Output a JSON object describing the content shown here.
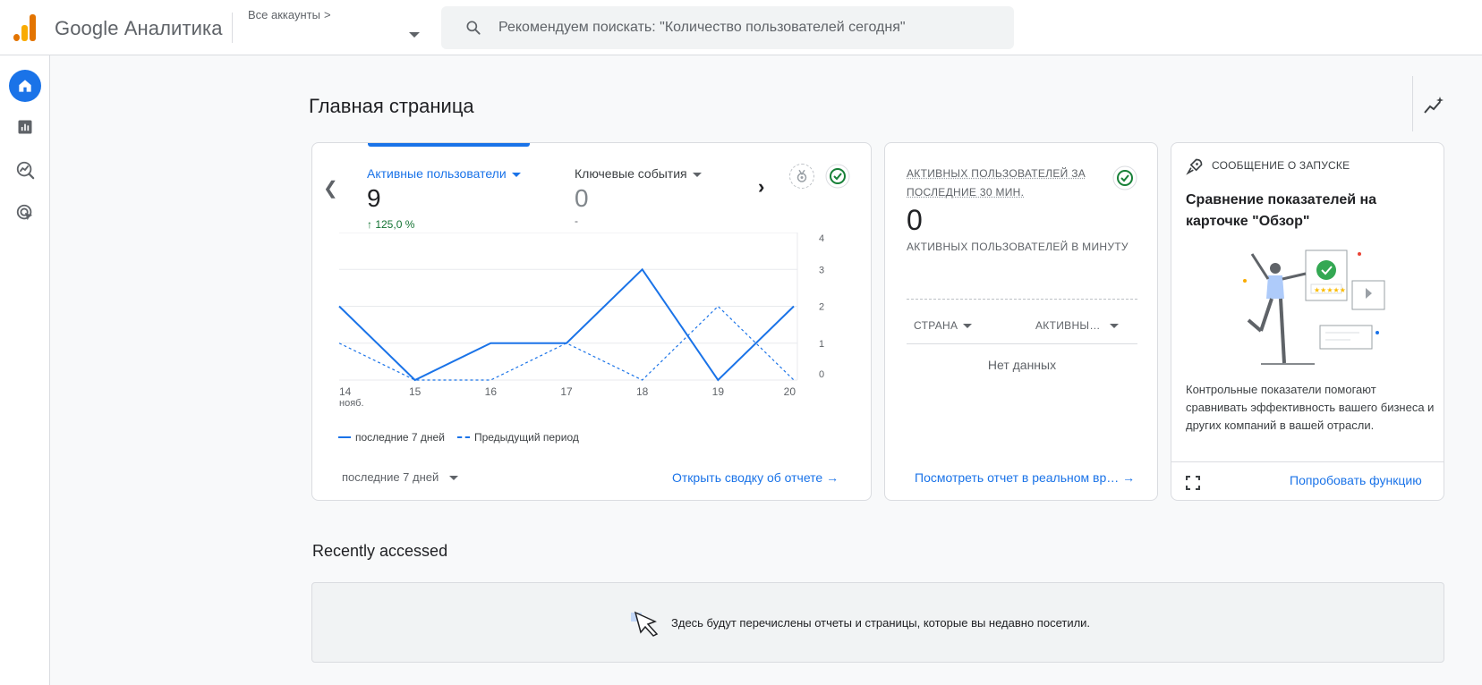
{
  "app": {
    "brand": "Google Аналитика",
    "accounts_label": "Все аккаунты",
    "accounts_chevron": ">"
  },
  "search": {
    "placeholder": "Рекомендуем поискать: \"Количество пользователей сегодня\""
  },
  "nav": {
    "items": [
      {
        "name": "home",
        "icon": "home-icon",
        "active": true
      },
      {
        "name": "reports",
        "icon": "bar-chart-icon",
        "active": false
      },
      {
        "name": "explore",
        "icon": "explore-icon",
        "active": false
      },
      {
        "name": "advertising",
        "icon": "ads-target-icon",
        "active": false
      }
    ]
  },
  "page": {
    "title": "Главная страница"
  },
  "overview_card": {
    "metric1": {
      "label": "Активные пользователи",
      "value": "9",
      "delta": "↑ 125,0 %"
    },
    "metric2": {
      "label": "Ключевые события",
      "value": "0",
      "delta": "-"
    },
    "legend_current": "последние 7 дней",
    "legend_previous": "Предыдущий период",
    "period_select": "последние 7 дней",
    "link": "Открыть сводку об отчете →"
  },
  "chart_data": {
    "type": "line",
    "x": [
      "14",
      "15",
      "16",
      "17",
      "18",
      "19",
      "20"
    ],
    "x_sublabel_first": "нояб.",
    "y_ticks": [
      "0",
      "1",
      "2",
      "3",
      "4"
    ],
    "ylim": [
      0,
      4
    ],
    "series": [
      {
        "name": "последние 7 дней",
        "values": [
          2,
          0,
          1,
          1,
          3,
          0,
          2
        ],
        "style": "solid"
      },
      {
        "name": "Предыдущий период",
        "values": [
          1,
          0,
          0,
          1,
          0,
          2,
          0
        ],
        "style": "dashed"
      }
    ],
    "color": "#1a73e8",
    "grid": true
  },
  "realtime_card": {
    "title": "АКТИВНЫХ ПОЛЬЗОВАТЕЛЕЙ ЗА ПОСЛЕДНИЕ 30 МИН.",
    "value": "0",
    "subtitle": "АКТИВНЫХ ПОЛЬЗОВАТЕЛЕЙ В МИНУТУ",
    "col1": "СТРАНА",
    "col2": "АКТИВНЫ…",
    "no_data": "Нет данных",
    "link": "Посмотреть отчет в реальном вр… →"
  },
  "launch_card": {
    "label": "СООБЩЕНИЕ О ЗАПУСКЕ",
    "title": "Сравнение показателей на карточке \"Обзор\"",
    "description": "Контрольные показатели помогают сравнивать эффективность вашего бизнеса и других компаний в вашей отрасли.",
    "link": "Попробовать функцию"
  },
  "recent": {
    "title": "Recently accessed",
    "message": "Здесь будут перечислены отчеты и страницы, которые вы недавно посетили."
  },
  "colors": {
    "accent": "#1a73e8",
    "positive": "#137333",
    "check_green": "#188038",
    "brand_orange": "#e37400",
    "brand_yellow": "#f9ab00"
  }
}
